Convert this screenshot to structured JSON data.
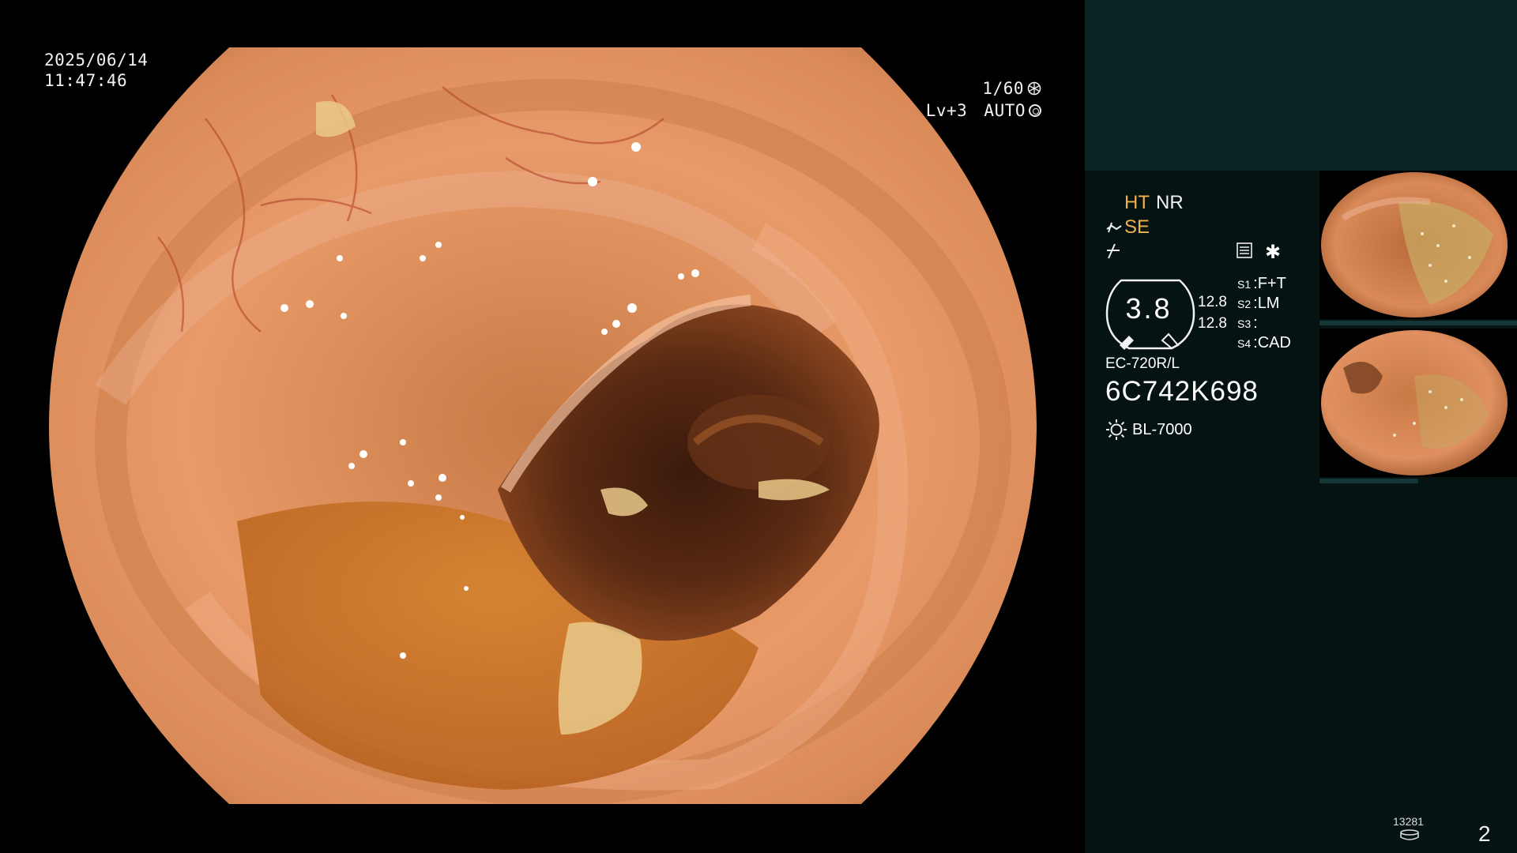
{
  "timestamp": {
    "date": "2025/06/14",
    "time": "11:47:46"
  },
  "exposure": {
    "shutter": "1/60",
    "level": "Lv+3",
    "mode": "AUTO"
  },
  "image_settings": {
    "ht": "HT",
    "nr": "NR",
    "se": "SE",
    "structure_value": "3.8",
    "value_a": "12.8",
    "value_b": "12.8",
    "switches": [
      {
        "key": "S1",
        "value": "F+T"
      },
      {
        "key": "S2",
        "value": "LM"
      },
      {
        "key": "S3",
        "value": ""
      },
      {
        "key": "S4",
        "value": "CAD"
      }
    ]
  },
  "scope": {
    "model": "EC-720R/L",
    "serial": "6C742K698",
    "light_source": "BL-7000"
  },
  "status": {
    "count": "13281",
    "page": "2"
  },
  "colors": {
    "accent": "#f0b24a",
    "panel_bg": "#061313",
    "panel_top": "#0b2526"
  },
  "icons": [
    "shutter-icon",
    "auto-iris-icon",
    "scope-icon",
    "freeze-icon",
    "memo-icon",
    "asterisk-icon",
    "light-source-icon",
    "storage-icon"
  ]
}
